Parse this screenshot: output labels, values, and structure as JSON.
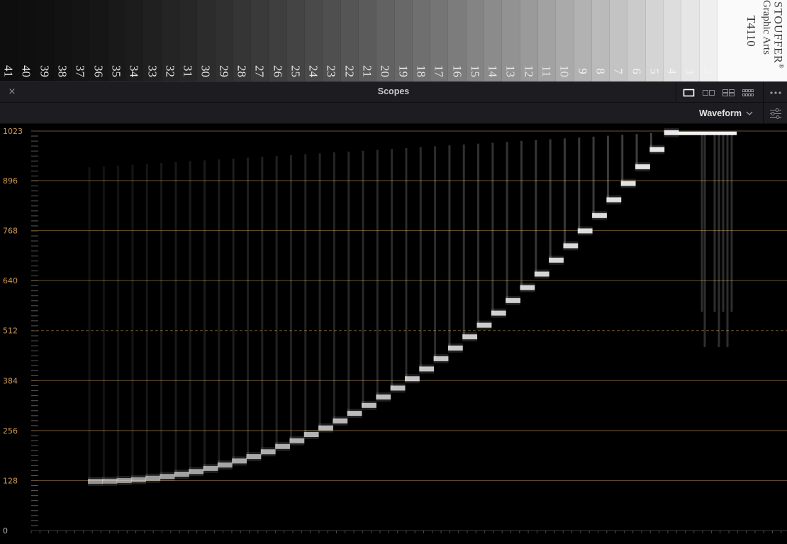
{
  "wedge": {
    "steps": [
      "41",
      "40",
      "39",
      "38",
      "37",
      "36",
      "35",
      "34",
      "33",
      "32",
      "31",
      "30",
      "29",
      "28",
      "27",
      "26",
      "25",
      "24",
      "23",
      "22",
      "21",
      "20",
      "19",
      "18",
      "17",
      "16",
      "15",
      "14",
      "13",
      "12",
      "11",
      "10",
      "9",
      "8",
      "7",
      "6",
      "5",
      "4",
      "3",
      "2"
    ],
    "brand_line_1": "STOUFFER",
    "brand_reg": "®",
    "brand_line_2": "Graphic Arts",
    "brand_line_3": "T4110"
  },
  "panel": {
    "title": "Scopes",
    "close_symbol": "×",
    "layout_buttons": [
      "single-view-icon",
      "dual-view-icon",
      "quad-view-icon",
      "grid-view-icon"
    ],
    "more_icon": "ellipsis-icon"
  },
  "toolbar": {
    "mode_label": "Waveform",
    "mode_chevron": "chevron-down-icon",
    "settings_icon": "sliders-icon"
  },
  "scope": {
    "axis_labels": [
      "1023",
      "896",
      "768",
      "640",
      "512",
      "384",
      "256",
      "128",
      "0"
    ],
    "axis_values": [
      1023,
      896,
      768,
      640,
      512,
      384,
      256,
      128,
      0
    ],
    "midline_value": 512,
    "colors": {
      "gridline": "#6b5432",
      "label": "#d09a55",
      "trace": "#f2f2f2",
      "background": "#000000"
    }
  }
}
